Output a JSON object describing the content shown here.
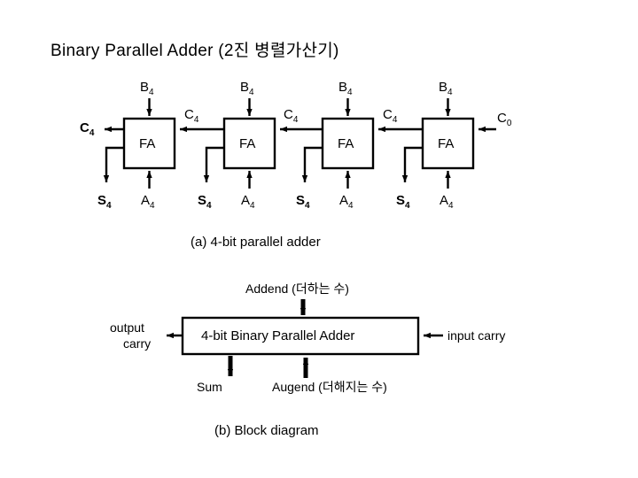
{
  "title": "Binary Parallel Adder (2진 병렬가산기)",
  "figure_a": {
    "caption": "(a) 4-bit parallel adder",
    "cells": [
      {
        "name": "FA",
        "top_input": "B",
        "top_sub": "4",
        "bottom_input": "A",
        "bottom_sub": "4",
        "sum_output": "S",
        "sum_sub": "4",
        "carry_out_label": "C",
        "carry_out_sub": "4",
        "carry_in_label": "C",
        "carry_in_sub": "4"
      },
      {
        "name": "FA",
        "top_input": "B",
        "top_sub": "4",
        "bottom_input": "A",
        "bottom_sub": "4",
        "sum_output": "S",
        "sum_sub": "4",
        "carry_out_label": "C",
        "carry_out_sub": "4",
        "carry_in_label": "C",
        "carry_in_sub": "4"
      },
      {
        "name": "FA",
        "top_input": "B",
        "top_sub": "4",
        "bottom_input": "A",
        "bottom_sub": "4",
        "sum_output": "S",
        "sum_sub": "4",
        "carry_out_label": "C",
        "carry_out_sub": "4",
        "carry_in_label": "C",
        "carry_in_sub": "4"
      },
      {
        "name": "FA",
        "top_input": "B",
        "top_sub": "4",
        "bottom_input": "A",
        "bottom_sub": "4",
        "sum_output": "S",
        "sum_sub": "4",
        "carry_out_label": "C",
        "carry_out_sub": "4",
        "carry_in_label": "C",
        "carry_in_sub": "0"
      }
    ],
    "final_carry_out": "C",
    "final_carry_out_sub": "4",
    "initial_carry_in": "C",
    "initial_carry_in_sub": "0"
  },
  "figure_b": {
    "caption": "(b) Block diagram",
    "block_label": "4-bit Binary Parallel Adder",
    "addend_label": "Addend (더하는 수)",
    "augend_label": "Augend (더해지는 수)",
    "sum_label": "Sum",
    "output_carry_line1": "output",
    "output_carry_line2": "carry",
    "input_carry_label": "input carry"
  },
  "colors": {
    "background": "#ffffff",
    "ink": "#000000"
  }
}
